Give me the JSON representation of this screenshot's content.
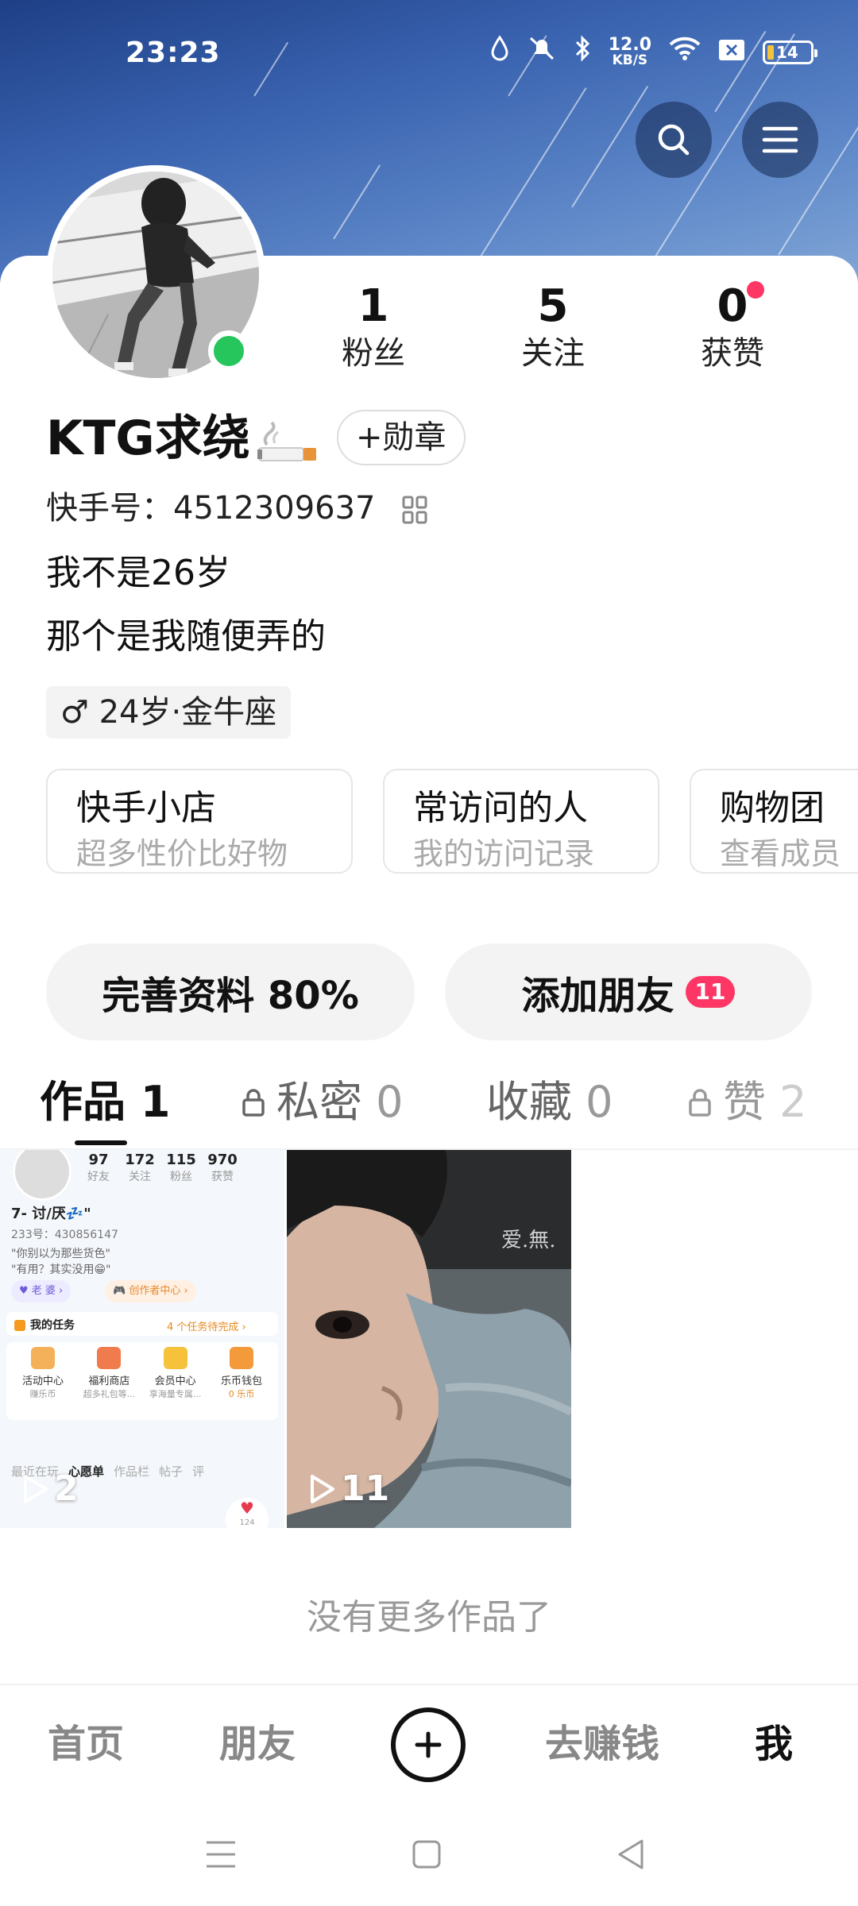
{
  "status_bar": {
    "time": "23:23",
    "net_speed_value": "12.0",
    "net_speed_unit": "KB/S",
    "battery": "14"
  },
  "profile": {
    "name": "KTG求绕",
    "badge_button": "+勋章",
    "kuaishou_id_label": "快手号：",
    "kuaishou_id": "4512309637",
    "bio_line1": "我不是26岁",
    "bio_line2": "那个是我随便弄的",
    "tag": "♂ 24岁·金牛座"
  },
  "stats": [
    {
      "num": "1",
      "label": "粉丝"
    },
    {
      "num": "5",
      "label": "关注"
    },
    {
      "num": "0",
      "label": "获赞"
    }
  ],
  "services": [
    {
      "title": "快手小店",
      "subtitle": "超多性价比好物"
    },
    {
      "title": "常访问的人",
      "subtitle": "我的访问记录"
    },
    {
      "title": "购物团",
      "subtitle": "查看成员"
    }
  ],
  "actions": {
    "complete_profile": "完善资料 80%",
    "add_friends": "添加朋友",
    "add_friends_count": "11"
  },
  "tabs": [
    {
      "label": "作品",
      "count": "1"
    },
    {
      "label": "私密",
      "count": "0"
    },
    {
      "label": "收藏",
      "count": "0"
    },
    {
      "label": "赞",
      "count": "2"
    }
  ],
  "works": [
    {
      "plays": "2",
      "inner": {
        "stats": [
          {
            "num": "97",
            "label": "好友"
          },
          {
            "num": "172",
            "label": "关注"
          },
          {
            "num": "115",
            "label": "粉丝"
          },
          {
            "num": "970",
            "label": "获赞"
          }
        ],
        "name": "7- 讨/厌💤\"",
        "id": "233号：430856147",
        "bio1": "\"你别以为那些货色\"",
        "bio2": "\"有用？其实没用😁\"",
        "chip1": "♥ 老 婆 ›",
        "chip2": "🎮 创作者中心 ›",
        "task_title": "我的任务",
        "task_status": "4 个任务待完成 ›",
        "grid": [
          {
            "title": "活动中心",
            "sub": "赚乐币"
          },
          {
            "title": "福利商店",
            "sub": "超多礼包等..."
          },
          {
            "title": "会员中心",
            "sub": "享海量专属..."
          },
          {
            "title": "乐币钱包",
            "sub": "0 乐币"
          }
        ],
        "tabs": [
          "最近在玩",
          "心愿单",
          "作品栏",
          "帖子",
          "评"
        ],
        "heart_count": "124"
      }
    },
    {
      "plays": "11",
      "watermark": "爱.無."
    }
  ],
  "no_more": "没有更多作品了",
  "bottom_nav": [
    "首页",
    "朋友",
    "去赚钱",
    "我"
  ]
}
